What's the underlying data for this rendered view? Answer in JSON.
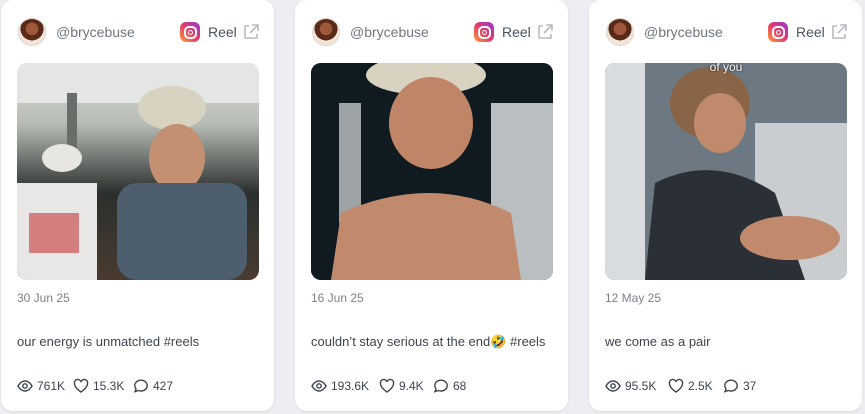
{
  "colors": {
    "accent": "#e53a6a",
    "text": "#3d4450",
    "muted": "#7b818b"
  },
  "posts": [
    {
      "handle": "@brycebuse",
      "platform_icon": "instagram-icon",
      "type": "Reel",
      "media_caption": "",
      "date": "30 Jun 25",
      "caption": "our energy is unmatched #reels",
      "views": "761K",
      "likes": "15.3K",
      "comments": "427"
    },
    {
      "handle": "@brycebuse",
      "platform_icon": "instagram-icon",
      "type": "Reel",
      "media_caption": "",
      "date": "16 Jun 25",
      "caption": "couldn’t stay serious at the end🤣 #reels",
      "views": "193.6K",
      "likes": "9.4K",
      "comments": "68"
    },
    {
      "handle": "@brycebuse",
      "platform_icon": "instagram-icon",
      "type": "Reel",
      "media_caption": "of you",
      "date": "12 May 25",
      "caption": "we come as a pair",
      "views": "95.5K",
      "likes": "2.5K",
      "comments": "37"
    }
  ]
}
